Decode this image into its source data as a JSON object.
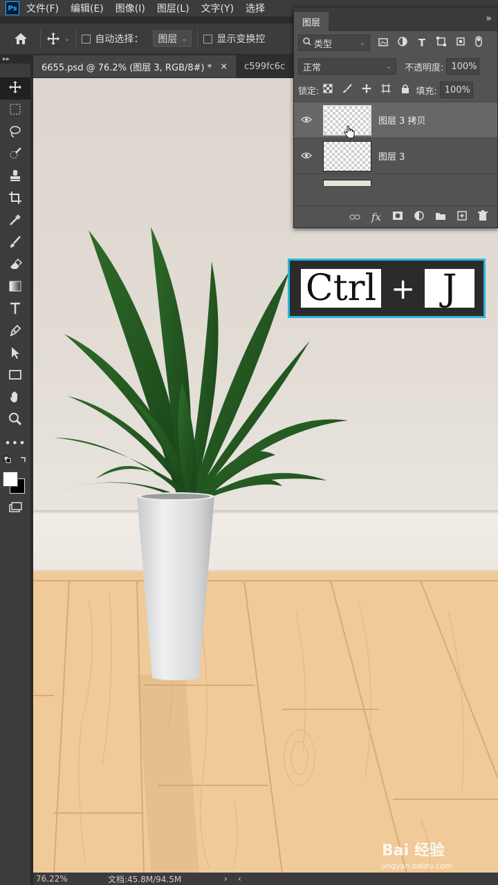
{
  "menu": {
    "logo": "Ps",
    "items": [
      "文件(F)",
      "编辑(E)",
      "图像(I)",
      "图层(L)",
      "文字(Y)",
      "选择"
    ]
  },
  "options": {
    "auto_select_label": "自动选择：",
    "auto_select_target": "图层",
    "show_transform_label": "显示变换控"
  },
  "tabs": [
    {
      "label": "6655.psd @ 76.2% (图层 3, RGB/8#) *",
      "close": "×"
    },
    {
      "label": "c599fc6c"
    }
  ],
  "layers_panel": {
    "tab_title": "图层",
    "menu_glyph": "»",
    "filter_label": "类型",
    "blend_mode": "正常",
    "opacity_label": "不透明度:",
    "opacity_value": "100%",
    "lock_label": "锁定:",
    "fill_label": "填充:",
    "fill_value": "100%",
    "layers": [
      {
        "name": "图层 3 拷贝",
        "visible": true,
        "selected": true
      },
      {
        "name": "图层 3",
        "visible": true,
        "selected": false
      }
    ],
    "footer_fx": "fx"
  },
  "shortcut": {
    "key1": "Ctrl",
    "plus": "+",
    "key2": "J"
  },
  "status": {
    "zoom": "76.22%",
    "doc": "文档:45.8M/94.5M",
    "arrow": "›",
    "scroll_left": "‹"
  },
  "watermark": {
    "main": "Bai 经验",
    "sub": "jingyan.baidu.com"
  },
  "colors": {
    "accent_border": "#2ab3e3",
    "ps_blue": "#31a8ff",
    "floor": "#f0ca98",
    "wall": "#e2dcd5"
  }
}
